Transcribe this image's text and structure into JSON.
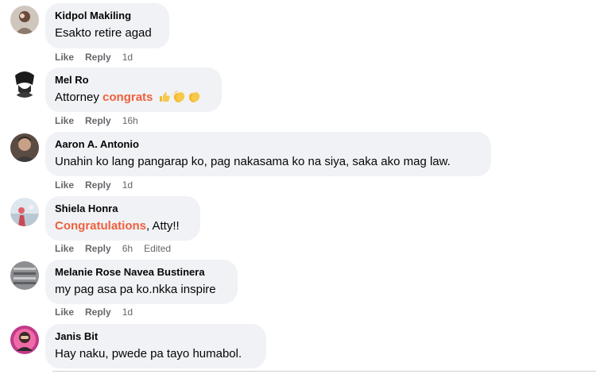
{
  "actions": {
    "like": "Like",
    "reply": "Reply"
  },
  "accent_color": "#f0603c",
  "comments": [
    {
      "author": "Kidpol Makiling",
      "text": "Esakto retire agad",
      "time": "1d"
    },
    {
      "author": "Mel Ro",
      "text_before": "Attorney ",
      "highlight": "congrats",
      "emojis": [
        "thumbs-up-emoji",
        "clapping-hands-emoji",
        "clapping-hands-emoji"
      ],
      "time": "16h"
    },
    {
      "author": "Aaron A. Antonio",
      "text": "Unahin ko lang pangarap ko, pag nakasama ko na siya, saka ako mag law.",
      "time": "1d"
    },
    {
      "author": "Shiela Honra",
      "highlight": "Congratulations",
      "text_after": ", Atty!!",
      "time": "6h",
      "edited": "Edited"
    },
    {
      "author": "Melanie Rose Navea Bustinera",
      "text": "my pag asa pa ko.nkka inspire",
      "time": "1d"
    },
    {
      "author": "Janis Bit",
      "text": "Hay naku, pwede pa tayo humabol."
    }
  ]
}
